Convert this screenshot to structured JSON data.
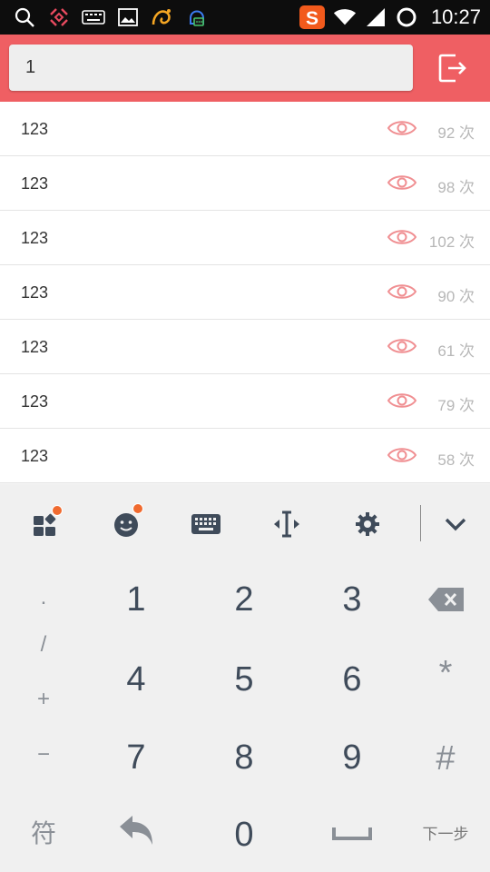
{
  "status_bar": {
    "time": "10:27",
    "icons": [
      "search-icon",
      "broken-link-icon",
      "keyboard-icon",
      "image-icon",
      "uc-browser-icon",
      "qq-icon"
    ],
    "right_icons": [
      "sogou-icon",
      "wifi-icon",
      "signal-icon",
      "loading-icon"
    ]
  },
  "header": {
    "search_value": "1",
    "exit_icon": "exit-icon",
    "color": "#ef5f63"
  },
  "list": [
    {
      "title": "123",
      "count": "92 次"
    },
    {
      "title": "123",
      "count": "98 次"
    },
    {
      "title": "123",
      "count": "102 次"
    },
    {
      "title": "123",
      "count": "90 次"
    },
    {
      "title": "123",
      "count": "61 次"
    },
    {
      "title": "123",
      "count": "79 次"
    },
    {
      "title": "123",
      "count": "58 次"
    }
  ],
  "keyboard": {
    "toolbar_icons": [
      "apps-icon",
      "emoji-icon",
      "keyboard-icon",
      "cursor-icon",
      "settings-icon",
      "collapse-icon"
    ],
    "side_symbols": [
      ".",
      "/",
      "+",
      "−"
    ],
    "digits": [
      "1",
      "2",
      "3",
      "4",
      "5",
      "6",
      "7",
      "8",
      "9",
      "0"
    ],
    "right_keys": [
      "*",
      "#"
    ],
    "bottom_left": "符",
    "next_label": "下一步"
  }
}
